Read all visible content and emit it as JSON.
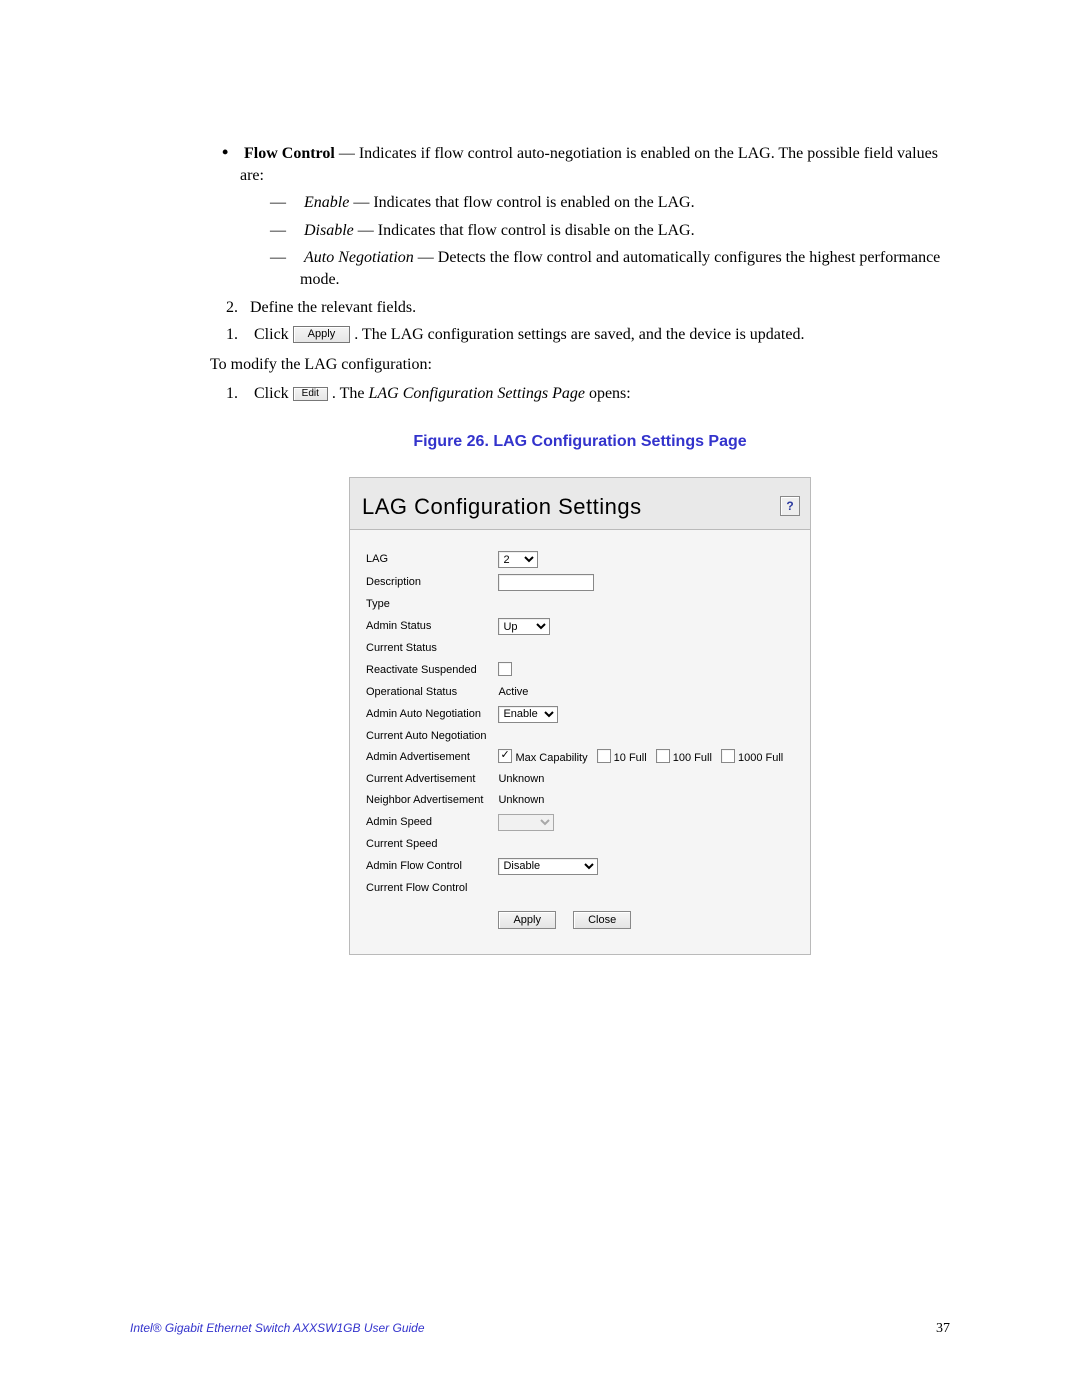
{
  "flow_control": {
    "heading": "Flow Control",
    "desc": " — Indicates if flow control auto-negotiation is enabled on the LAG. The possible field values are:",
    "enable_term": "Enable",
    "enable_desc": " — Indicates that flow control is enabled on the LAG.",
    "disable_term": "Disable",
    "disable_desc": " — Indicates that flow control is disable on the LAG.",
    "auto_term": "Auto Negotiation",
    "auto_desc": " — Detects the flow control and automatically configures the highest performance mode."
  },
  "step2": "Define the relevant fields.",
  "step3_a": "Click ",
  "step3_btn": "Apply",
  "step3_b": ". The LAG configuration settings are saved, and the device is updated.",
  "modify_intro": "To modify the LAG configuration:",
  "step_m1_a": "Click ",
  "step_m1_btn": "Edit",
  "step_m1_b": ". The ",
  "step_m1_em": "LAG Configuration Settings Page",
  "step_m1_c": " opens:",
  "figure_caption": "Figure 26. LAG Configuration Settings Page",
  "panel": {
    "title": "LAG Configuration Settings",
    "help": "?",
    "labels": {
      "lag": "LAG",
      "description": "Description",
      "type": "Type",
      "admin_status": "Admin Status",
      "current_status": "Current Status",
      "reactivate_suspended": "Reactivate Suspended",
      "operational_status": "Operational Status",
      "admin_auto_neg": "Admin Auto Negotiation",
      "current_auto_neg": "Current Auto Negotiation",
      "admin_advert": "Admin Advertisement",
      "current_advert": "Current Advertisement",
      "neighbor_advert": "Neighbor Advertisement",
      "admin_speed": "Admin Speed",
      "current_speed": "Current Speed",
      "admin_flow_control": "Admin Flow Control",
      "current_flow_control": "Current Flow Control"
    },
    "values": {
      "lag": "2",
      "description": "",
      "type": "",
      "admin_status": "Up",
      "current_status": "",
      "reactivate_checked": false,
      "operational_status": "Active",
      "admin_auto_neg": "Enable",
      "current_auto_neg": "",
      "adv_max_cap": true,
      "adv_max_cap_label": "Max Capability",
      "adv_10_full": false,
      "adv_10_full_label": "10 Full",
      "adv_100_full": false,
      "adv_100_full_label": "100 Full",
      "adv_1000_full": false,
      "adv_1000_full_label": "1000 Full",
      "current_advert": "Unknown",
      "neighbor_advert": "Unknown",
      "admin_speed": "",
      "current_speed": "",
      "admin_flow_control": "Disable",
      "current_flow_control": ""
    },
    "buttons": {
      "apply": "Apply",
      "close": "Close"
    }
  },
  "footer": {
    "title": "Intel® Gigabit Ethernet Switch AXXSW1GB User Guide",
    "page": "37"
  }
}
